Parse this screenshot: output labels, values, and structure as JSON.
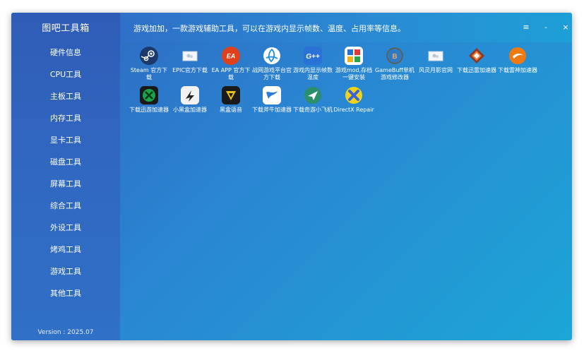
{
  "app": {
    "title": "图吧工具箱",
    "version": "Version : 2025.07",
    "header_text": "游戏加加，一款游戏辅助工具，可以在游戏内显示帧数、温度、占用率等信息。",
    "controls": {
      "menu": "≡",
      "minimize": "-",
      "close": "×"
    }
  },
  "sidebar": {
    "items": [
      {
        "label": "硬件信息"
      },
      {
        "label": "CPU工具"
      },
      {
        "label": "主板工具"
      },
      {
        "label": "内存工具"
      },
      {
        "label": "显卡工具"
      },
      {
        "label": "磁盘工具"
      },
      {
        "label": "屏幕工具"
      },
      {
        "label": "综合工具"
      },
      {
        "label": "外设工具"
      },
      {
        "label": "烤鸡工具"
      },
      {
        "label": "游戏工具"
      },
      {
        "label": "其他工具"
      }
    ]
  },
  "tiles": [
    {
      "label": "Steam 官方下载",
      "icon": "steam-icon",
      "color": "#1b3a6b"
    },
    {
      "label": "EPIC官方下载",
      "icon": "image-placeholder-icon",
      "color": "#e8eef4"
    },
    {
      "label": "EA APP 官方下载",
      "icon": "ea-icon",
      "color": "#e0401c"
    },
    {
      "label": "战网游戏平台官方下载",
      "icon": "battlenet-icon",
      "color": "#1a8fe0"
    },
    {
      "label": "游戏内显示帧数温度",
      "icon": "gplus-icon",
      "color": "#2b72d8"
    },
    {
      "label": "游戏mod,存档一键安装",
      "icon": "mod-icon",
      "color": "#ffffff"
    },
    {
      "label": "GameBuff单机游戏修改器",
      "icon": "gamebuff-icon",
      "color": "#2f7ac0"
    },
    {
      "label": "风灵月影官网",
      "icon": "image-placeholder-icon",
      "color": "#e8eef4"
    },
    {
      "label": "下载迅雷加速器",
      "icon": "thunder-icon",
      "color": "#8a3a2a"
    },
    {
      "label": "下载雷神加速器",
      "icon": "leishen-icon",
      "color": "#f07a10"
    },
    {
      "label": "下载迅游加速器",
      "icon": "xunyou-icon",
      "color": "#1ea24a"
    },
    {
      "label": "小黑盒加速器",
      "icon": "heihe-icon",
      "color": "#f2f2f2"
    },
    {
      "label": "黑盒语音",
      "icon": "heihe-voice-icon",
      "color": "#1a1a1a"
    },
    {
      "label": "下载斧牛加速器",
      "icon": "funiu-icon",
      "color": "#ffffff"
    },
    {
      "label": "下载奇游小飞机",
      "icon": "qiyou-icon",
      "color": "#2a8f6a"
    },
    {
      "label": "DirectX Repair",
      "icon": "directx-icon",
      "color": "#3a64d8"
    }
  ]
}
